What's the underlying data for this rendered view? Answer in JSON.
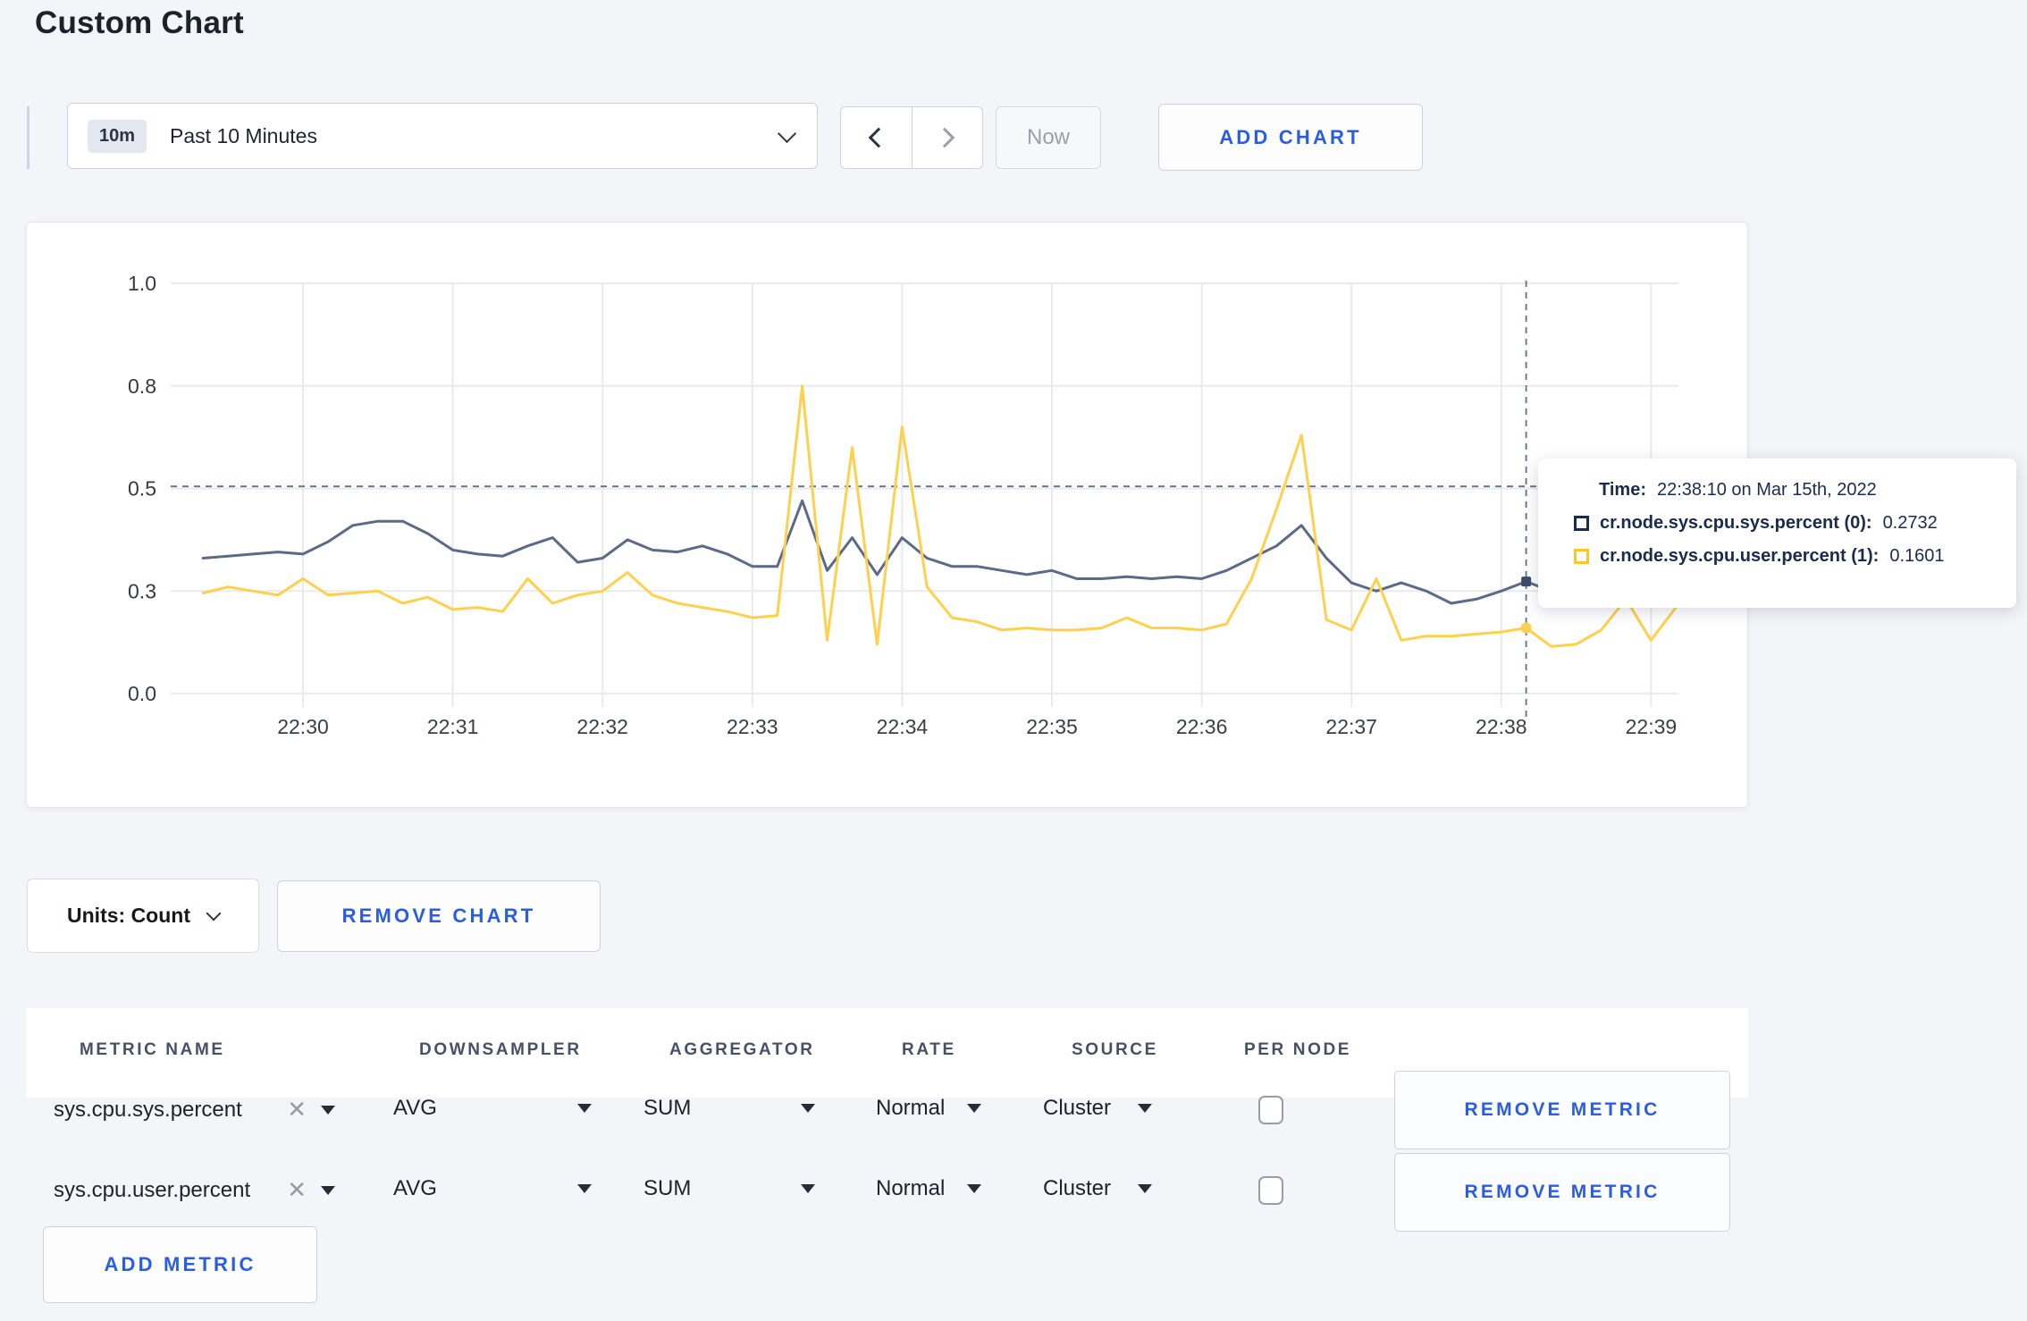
{
  "page": {
    "title": "Custom Chart",
    "background": "#f4f5f8",
    "accent_blue": "#2a5ce4"
  },
  "toolbar": {
    "time_range_badge": "10m",
    "time_range_label": "Past 10 Minutes",
    "now_label": "Now",
    "add_chart_label": "ADD CHART"
  },
  "tooltip": {
    "time_label": "Time:",
    "time_value": "22:38:10 on Mar 15th, 2022",
    "series": [
      {
        "label": "cr.node.sys.cpu.sys.percent (0):",
        "value": "0.2732",
        "swatch_color": "#1b2b4e"
      },
      {
        "label": "cr.node.sys.cpu.user.percent (1):",
        "value": "0.1601",
        "swatch_color": "#fdc52c"
      }
    ]
  },
  "units_bar": {
    "units_label": "Units: Count",
    "remove_chart_label": "REMOVE CHART"
  },
  "metrics_table": {
    "headers": [
      "METRIC NAME",
      "DOWNSAMPLER",
      "AGGREGATOR",
      "RATE",
      "SOURCE",
      "PER NODE"
    ],
    "rows": [
      {
        "metric": "sys.cpu.sys.percent",
        "downsampler": "AVG",
        "aggregator": "SUM",
        "rate": "Normal",
        "source": "Cluster",
        "per_node_checked": false,
        "remove_label": "REMOVE METRIC"
      },
      {
        "metric": "sys.cpu.user.percent",
        "downsampler": "AVG",
        "aggregator": "SUM",
        "rate": "Normal",
        "source": "Cluster",
        "per_node_checked": false,
        "remove_label": "REMOVE METRIC"
      }
    ],
    "add_metric_label": "ADD METRIC"
  },
  "chart_data": {
    "type": "line",
    "title": "",
    "xlabel": "",
    "ylabel": "",
    "ylim": [
      0,
      1
    ],
    "grid": true,
    "legend_position": "tooltip",
    "x": [
      "22:29:20",
      "22:29:30",
      "22:29:40",
      "22:29:50",
      "22:30:00",
      "22:30:10",
      "22:30:20",
      "22:30:30",
      "22:30:40",
      "22:30:50",
      "22:31:00",
      "22:31:10",
      "22:31:20",
      "22:31:30",
      "22:31:40",
      "22:31:50",
      "22:32:00",
      "22:32:10",
      "22:32:20",
      "22:32:30",
      "22:32:40",
      "22:32:50",
      "22:33:00",
      "22:33:10",
      "22:33:20",
      "22:33:30",
      "22:33:40",
      "22:33:50",
      "22:34:00",
      "22:34:10",
      "22:34:20",
      "22:34:30",
      "22:34:40",
      "22:34:50",
      "22:35:00",
      "22:35:10",
      "22:35:20",
      "22:35:30",
      "22:35:40",
      "22:35:50",
      "22:36:00",
      "22:36:10",
      "22:36:20",
      "22:36:30",
      "22:36:40",
      "22:36:50",
      "22:37:00",
      "22:37:10",
      "22:37:20",
      "22:37:30",
      "22:37:40",
      "22:37:50",
      "22:38:00",
      "22:38:10",
      "22:38:20",
      "22:38:30",
      "22:38:40",
      "22:38:50",
      "22:39:00",
      "22:39:10"
    ],
    "series": [
      {
        "name": "cr.node.sys.cpu.sys.percent",
        "color": "#5c6a85",
        "values": [
          0.33,
          0.335,
          0.34,
          0.345,
          0.34,
          0.37,
          0.41,
          0.42,
          0.42,
          0.39,
          0.35,
          0.34,
          0.335,
          0.36,
          0.38,
          0.32,
          0.33,
          0.375,
          0.35,
          0.345,
          0.36,
          0.34,
          0.31,
          0.31,
          0.47,
          0.3,
          0.38,
          0.29,
          0.38,
          0.33,
          0.31,
          0.31,
          0.3,
          0.29,
          0.3,
          0.28,
          0.28,
          0.285,
          0.28,
          0.285,
          0.28,
          0.3,
          0.33,
          0.36,
          0.41,
          0.33,
          0.27,
          0.25,
          0.27,
          0.25,
          0.22,
          0.23,
          0.25,
          0.2732,
          0.25,
          0.26,
          0.27,
          0.28,
          0.3,
          0.31
        ]
      },
      {
        "name": "cr.node.sys.cpu.user.percent",
        "color": "#fdd04e",
        "values": [
          0.245,
          0.26,
          0.25,
          0.24,
          0.28,
          0.24,
          0.245,
          0.25,
          0.22,
          0.235,
          0.205,
          0.21,
          0.2,
          0.28,
          0.22,
          0.24,
          0.25,
          0.295,
          0.24,
          0.22,
          0.21,
          0.2,
          0.185,
          0.19,
          0.75,
          0.13,
          0.6,
          0.12,
          0.65,
          0.26,
          0.185,
          0.175,
          0.155,
          0.16,
          0.155,
          0.155,
          0.16,
          0.185,
          0.16,
          0.16,
          0.155,
          0.17,
          0.28,
          0.45,
          0.63,
          0.18,
          0.155,
          0.28,
          0.13,
          0.14,
          0.14,
          0.145,
          0.15,
          0.1601,
          0.115,
          0.12,
          0.155,
          0.23,
          0.13,
          0.21
        ]
      }
    ],
    "xticks": [
      "22:30",
      "22:31",
      "22:32",
      "22:33",
      "22:34",
      "22:35",
      "22:36",
      "22:37",
      "22:38",
      "22:39"
    ],
    "yticks": {
      "labels": [
        "0.0",
        "0.3",
        "0.5",
        "0.8",
        "1.0"
      ],
      "values": [
        0,
        0.25,
        0.5,
        0.75,
        1.0
      ]
    },
    "crosshair": {
      "time": "22:38:10",
      "x_index": 53,
      "y_value": 0.505
    }
  }
}
